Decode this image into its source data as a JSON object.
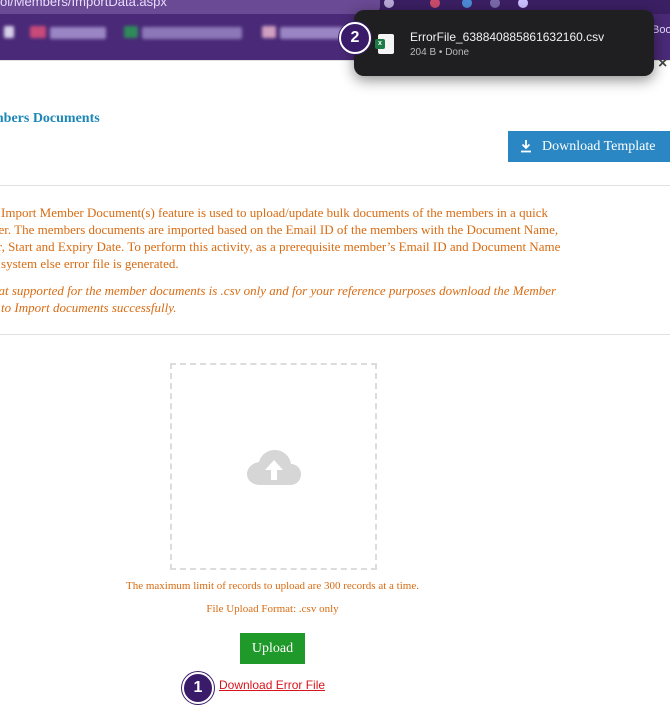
{
  "browser": {
    "url_text": "ol/Members/ImportData.aspx",
    "bookmark_label": "Boo",
    "toolbar_icon_colors": [
      "#c94c6b",
      "#4b8bd6",
      "#7a6aa8",
      "#c9c0ff"
    ]
  },
  "download_popup": {
    "file_name": "ErrorFile_638840885861632160.csv",
    "file_meta": "204 B • Done",
    "file_badge": "x"
  },
  "steps": {
    "one": "1",
    "two": "2"
  },
  "page": {
    "heading": "mbers Documents",
    "download_template_label": "Download Template",
    "description_lines": [
      "e Import Member Document(s) feature is used to upload/update bulk documents of the members in a quick",
      "ner. The members documents are imported based on the Email ID of the members with the Document Name,",
      "er, Start and Expiry Date. To perform this activity, as a prerequisite member’s Email ID and Document Name",
      "e system else error file is generated."
    ],
    "note_lines": [
      "nat supported for the member documents is .csv only and for your reference purposes download the Member",
      "e to Import documents successfully."
    ],
    "upload_limit_text": "The maximum limit of records to upload are 300 records at a time.",
    "file_format_text": "File Upload Format: .csv only",
    "upload_label": "Upload",
    "error_link_label": "Download Error File"
  },
  "colors": {
    "heading_blue": "#1d88b8",
    "template_button": "#2a87c3",
    "warning_orange": "#d86b12",
    "upload_green": "#1f9a2a",
    "error_red": "#d8141c",
    "step_purple": "#3a1b6a",
    "chrome_purple": "#3b1f63"
  }
}
